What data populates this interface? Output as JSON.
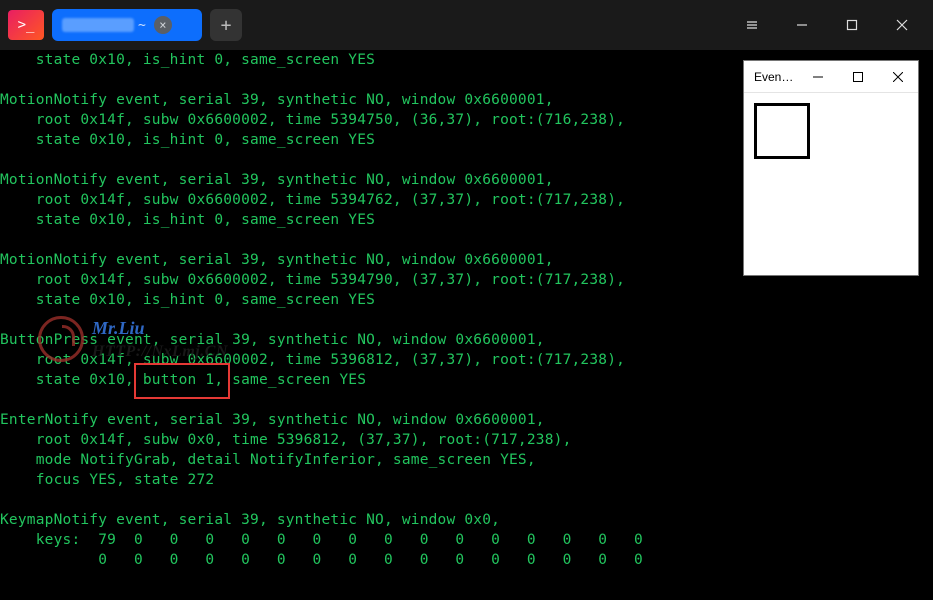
{
  "titlebar": {
    "app_icon_glyph": ">_",
    "tab_suffix": "~",
    "close_glyph": "×",
    "add_glyph": "+"
  },
  "event_window": {
    "title": "Even…"
  },
  "watermark": {
    "name": "Mr.Liu",
    "url": "HTTP://NxLmj.CN"
  },
  "terminal_lines": [
    "    state 0x10, is_hint 0, same_screen YES",
    "",
    "MotionNotify event, serial 39, synthetic NO, window 0x6600001,",
    "    root 0x14f, subw 0x6600002, time 5394750, (36,37), root:(716,238),",
    "    state 0x10, is_hint 0, same_screen YES",
    "",
    "MotionNotify event, serial 39, synthetic NO, window 0x6600001,",
    "    root 0x14f, subw 0x6600002, time 5394762, (37,37), root:(717,238),",
    "    state 0x10, is_hint 0, same_screen YES",
    "",
    "MotionNotify event, serial 39, synthetic NO, window 0x6600001,",
    "    root 0x14f, subw 0x6600002, time 5394790, (37,37), root:(717,238),",
    "    state 0x10, is_hint 0, same_screen YES",
    "",
    "ButtonPress event, serial 39, synthetic NO, window 0x6600001,",
    "    root 0x14f, subw 0x6600002, time 5396812, (37,37), root:(717,238),",
    "    state 0x10, button 1, same_screen YES",
    "",
    "EnterNotify event, serial 39, synthetic NO, window 0x6600001,",
    "    root 0x14f, subw 0x0, time 5396812, (37,37), root:(717,238),",
    "    mode NotifyGrab, detail NotifyInferior, same_screen YES,",
    "    focus YES, state 272",
    "",
    "KeymapNotify event, serial 39, synthetic NO, window 0x0,",
    "    keys:  79  0   0   0   0   0   0   0   0   0   0   0   0   0   0   0",
    "           0   0   0   0   0   0   0   0   0   0   0   0   0   0   0   0"
  ]
}
